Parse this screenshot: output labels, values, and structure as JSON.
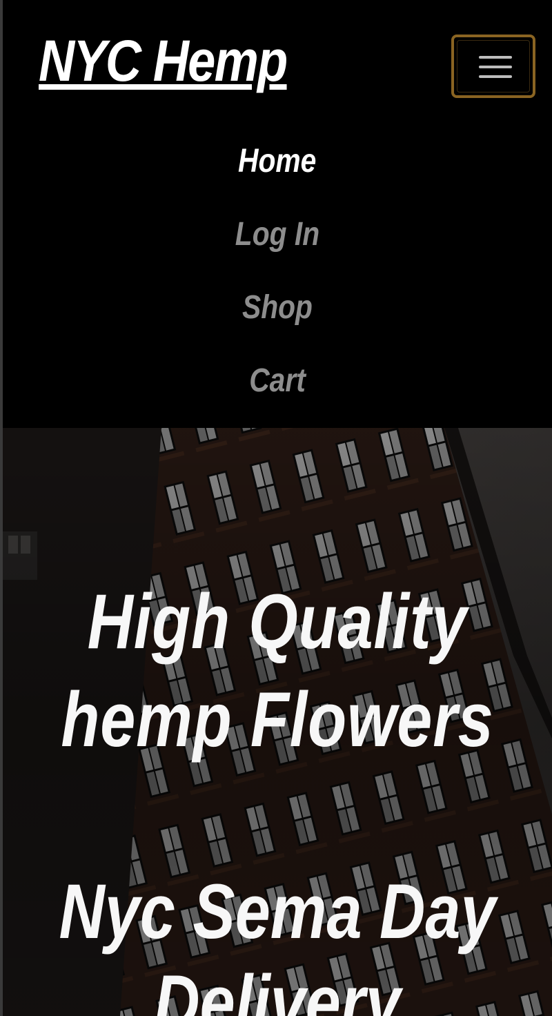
{
  "navbar": {
    "brand": "NYC Hemp",
    "toggler_icon": "hamburger-menu-icon",
    "items": [
      {
        "label": "Home",
        "active": true
      },
      {
        "label": "Log In",
        "active": false
      },
      {
        "label": "Shop",
        "active": false
      },
      {
        "label": "Cart",
        "active": false
      }
    ]
  },
  "hero": {
    "title_line1": "High Quality",
    "title_line2": "hemp Flowers",
    "subtitle_line1": "Nyc Sema Day",
    "subtitle_line2": "Delivery"
  },
  "colors": {
    "background": "#000000",
    "text_active": "#ffffff",
    "text_inactive": "#8d8d8d",
    "toggler_border": "#8a6422"
  }
}
